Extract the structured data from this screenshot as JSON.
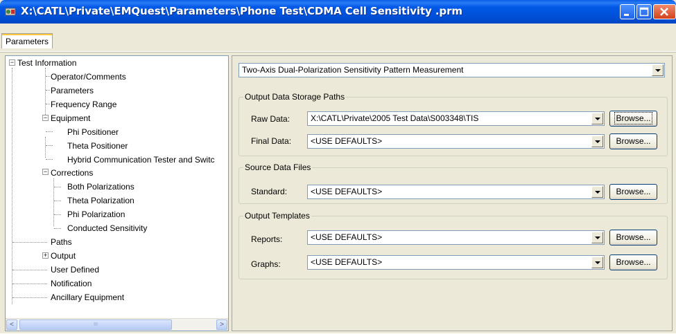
{
  "window": {
    "title": "X:\\CATL\\Private\\EMQuest\\Parameters\\Phone Test\\CDMA Cell Sensitivity .prm",
    "colors": {
      "titlebar": "#0058e6",
      "close": "#d3421c",
      "face": "#ece9d8"
    }
  },
  "tabs": [
    "Parameters"
  ],
  "tree": [
    {
      "label": "Test Information",
      "expander": "−"
    },
    {
      "label": "Operator/Comments"
    },
    {
      "label": "Parameters"
    },
    {
      "label": "Frequency Range"
    },
    {
      "label": "Equipment",
      "expander": "−"
    },
    {
      "label": "Phi Positioner"
    },
    {
      "label": "Theta Positioner"
    },
    {
      "label": "Hybrid Communication Tester and Switc"
    },
    {
      "label": "Corrections",
      "expander": "−"
    },
    {
      "label": "Both Polarizations"
    },
    {
      "label": "Theta Polarization"
    },
    {
      "label": "Phi Polarization"
    },
    {
      "label": "Conducted Sensitivity"
    },
    {
      "label": "Paths"
    },
    {
      "label": "Output",
      "expander": "+"
    },
    {
      "label": "User Defined"
    },
    {
      "label": "Notification"
    },
    {
      "label": "Ancillary Equipment"
    }
  ],
  "scroll": {
    "left": "<",
    "right": ">",
    "thumb": "III"
  },
  "measurement": {
    "selected": "Two-Axis Dual-Polarization Sensitivity Pattern Measurement"
  },
  "groups": {
    "storage": {
      "title": "Output Data Storage Paths",
      "raw_label": "Raw Data:",
      "raw_value": "X:\\CATL\\Private\\2005 Test Data\\S003348\\TIS",
      "final_label": "Final Data:",
      "final_value": "<USE DEFAULTS>"
    },
    "source": {
      "title": "Source Data Files",
      "standard_label": "Standard:",
      "standard_value": "<USE DEFAULTS>"
    },
    "templates": {
      "title": "Output Templates",
      "reports_label": "Reports:",
      "reports_value": "<USE DEFAULTS>",
      "graphs_label": "Graphs:",
      "graphs_value": "<USE DEFAULTS>"
    }
  },
  "browse_label": "Browse..."
}
